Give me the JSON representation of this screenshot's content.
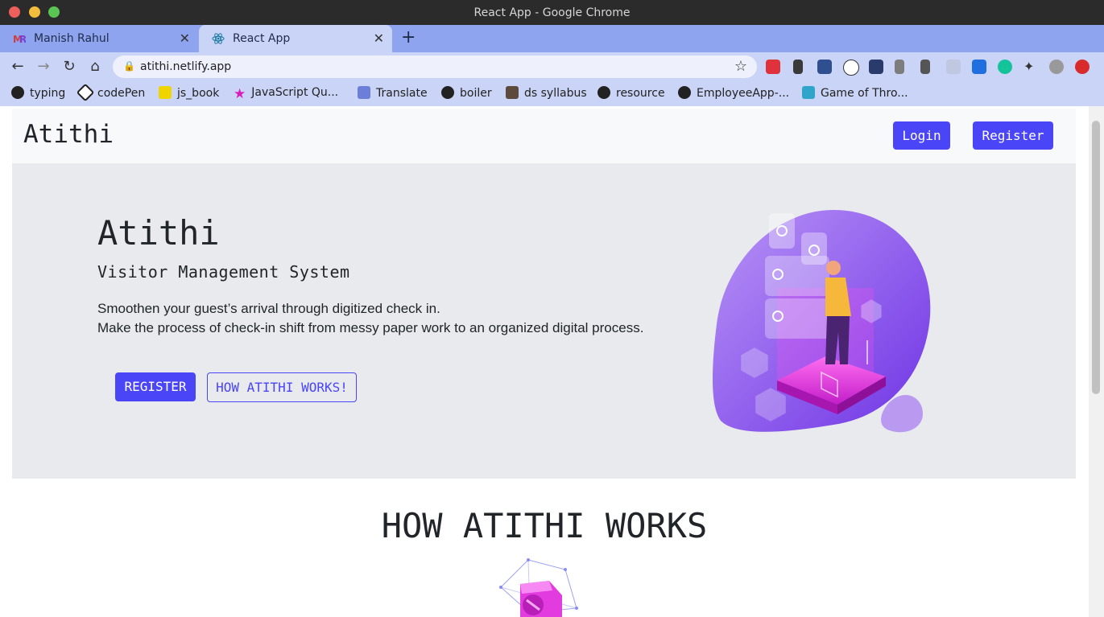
{
  "window": {
    "title": "React App - Google Chrome"
  },
  "tabs": [
    {
      "label": "Manish Rahul",
      "favicon": "mr-favicon",
      "active": false
    },
    {
      "label": "React App",
      "favicon": "react-favicon",
      "active": true
    }
  ],
  "toolbar": {
    "url": "atithi.netlify.app",
    "back_icon": "back-arrow-icon",
    "forward_icon": "forward-arrow-icon",
    "reload_icon": "reload-icon",
    "home_icon": "home-icon",
    "bookmark_star_icon": "star-icon"
  },
  "bookmarks": [
    {
      "label": "typing",
      "icon": "paw-icon"
    },
    {
      "label": "codePen",
      "icon": "codepen-icon"
    },
    {
      "label": "js_book",
      "icon": "ejs-icon"
    },
    {
      "label": "JavaScript Qu...",
      "icon": "star-icon"
    },
    {
      "label": "Translate",
      "icon": "translate-icon"
    },
    {
      "label": "boiler",
      "icon": "github-icon"
    },
    {
      "label": "ds syllabus",
      "icon": "cc-icon"
    },
    {
      "label": "resource",
      "icon": "github-icon"
    },
    {
      "label": "EmployeeApp-...",
      "icon": "github-icon"
    },
    {
      "label": "Game of Thro...",
      "icon": "got-icon"
    }
  ],
  "site": {
    "brand": "Atithi",
    "nav_login": "Login",
    "nav_register": "Register",
    "hero_title": "Atithi",
    "hero_subtitle": "Visitor Management System",
    "hero_line1": "Smoothen your guest’s arrival through digitized check in.",
    "hero_line2": "Make the process of check-in shift from messy paper work to an organized digital process.",
    "cta_register": "REGISTER",
    "cta_how": "HOW ATITHI WORKS!",
    "section_title": "HOW ATITHI WORKS"
  },
  "colors": {
    "accent": "#4a45f6",
    "hero_bg": "#e8eaed",
    "tab_strip": "#8ea4ee",
    "toolbar": "#c9d4f6"
  }
}
